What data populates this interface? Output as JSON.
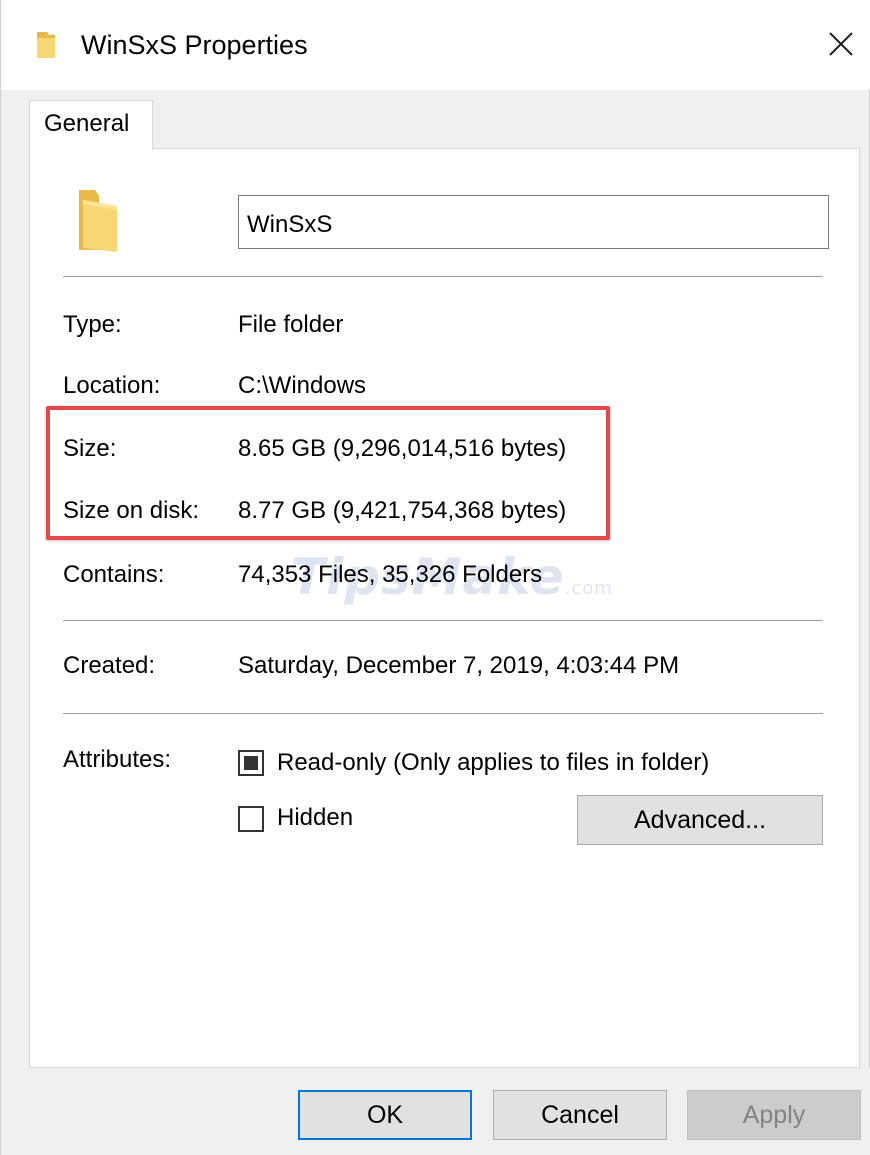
{
  "window": {
    "title": "WinSxS Properties",
    "close_glyph": "✕"
  },
  "tabs": [
    {
      "label": "General",
      "selected": true
    }
  ],
  "general": {
    "name_value": "WinSxS",
    "type_label": "Type:",
    "type_value": "File folder",
    "location_label": "Location:",
    "location_value": "C:\\Windows",
    "size_label": "Size:",
    "size_value": "8.65 GB (9,296,014,516 bytes)",
    "size_on_disk_label": "Size on disk:",
    "size_on_disk_value": "8.77 GB (9,421,754,368 bytes)",
    "contains_label": "Contains:",
    "contains_value": "74,353 Files, 35,326 Folders",
    "created_label": "Created:",
    "created_value": "Saturday, December 7, 2019, 4:03:44 PM",
    "attributes_label": "Attributes:",
    "readonly_label": "Read-only (Only applies to files in folder)",
    "readonly_state": "indeterminate",
    "hidden_label": "Hidden",
    "hidden_checked": false,
    "advanced_label": "Advanced..."
  },
  "watermark": {
    "text": "TipsMake",
    "suffix": ".com"
  },
  "footer": {
    "ok_label": "OK",
    "cancel_label": "Cancel",
    "apply_label": "Apply"
  },
  "colors": {
    "highlight": "#e8474a",
    "folder": "#f7d774",
    "default_button_border": "#0078d7"
  },
  "icons": {
    "title": "folder-icon",
    "big": "folder-icon",
    "close": "close-icon"
  }
}
